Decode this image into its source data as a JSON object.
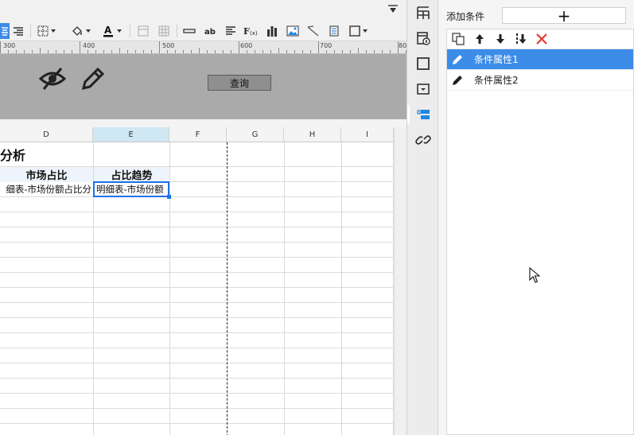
{
  "ruler": {
    "marks": [
      "300",
      "400",
      "500",
      "600",
      "700",
      "80"
    ]
  },
  "parameter_panel": {
    "query_button_label": "查询"
  },
  "grid": {
    "column_headers": [
      "D",
      "E",
      "F",
      "G",
      "H",
      "I"
    ],
    "report_title": "分析",
    "header_row": [
      "市场占比",
      "占比趋势"
    ],
    "data_row": [
      "细表-市场份额占比分",
      "明细表-市场份额"
    ]
  },
  "condition_panel": {
    "add_label": "添加条件",
    "add_button_symbol": "+",
    "items": [
      {
        "label": "条件属性1",
        "selected": true
      },
      {
        "label": "条件属性2",
        "selected": false
      }
    ]
  },
  "icons": {
    "toolbar": [
      "align-center-icon",
      "align-right-icon",
      "border-icon",
      "fill-color-icon",
      "font-color-icon",
      "merge-cells-icon",
      "table-icon",
      "underline-icon",
      "text-ab-icon",
      "align-left-icon",
      "formula-icon",
      "bar-chart-icon",
      "image-icon",
      "slash-icon",
      "frame-icon",
      "border-style-icon"
    ],
    "strip": [
      "cell-attr-icon",
      "widget-attr-icon",
      "border-attr-icon",
      "hyperlink-panel-icon",
      "condition-attr-icon",
      "link-icon"
    ],
    "list_tools": [
      "copy-icon",
      "move-up-icon",
      "move-down-icon",
      "move-bottom-icon",
      "delete-icon"
    ]
  },
  "colors": {
    "accent": "#3c8ce8",
    "selection": "#1a73e8",
    "delete": "#e53935",
    "param_bg": "#aaaaab"
  }
}
